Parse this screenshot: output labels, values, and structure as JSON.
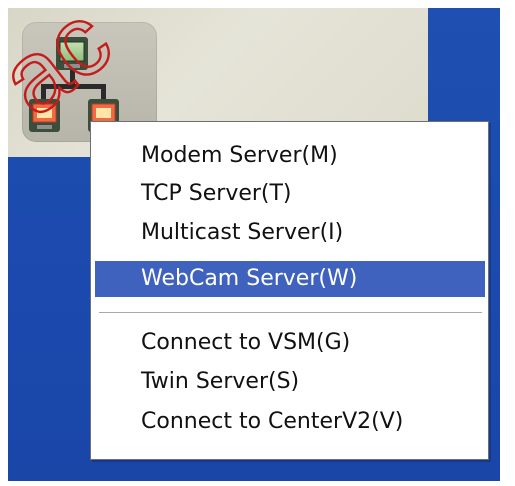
{
  "watermark": {
    "text": "ac"
  },
  "tray_icon": {
    "icon": "network-server-icon"
  },
  "context_menu": {
    "items": [
      {
        "label": "Modem Server(M)"
      },
      {
        "label": "TCP Server(T)"
      },
      {
        "label": "Multicast Server(I)"
      },
      {
        "label": "WebCam Server(W)",
        "highlighted": true
      },
      {
        "label": "Connect to VSM(G)"
      },
      {
        "label": "Twin Server(S)"
      },
      {
        "label": "Connect to CenterV2(V)"
      }
    ],
    "highlight_color": "#3f62bf"
  }
}
